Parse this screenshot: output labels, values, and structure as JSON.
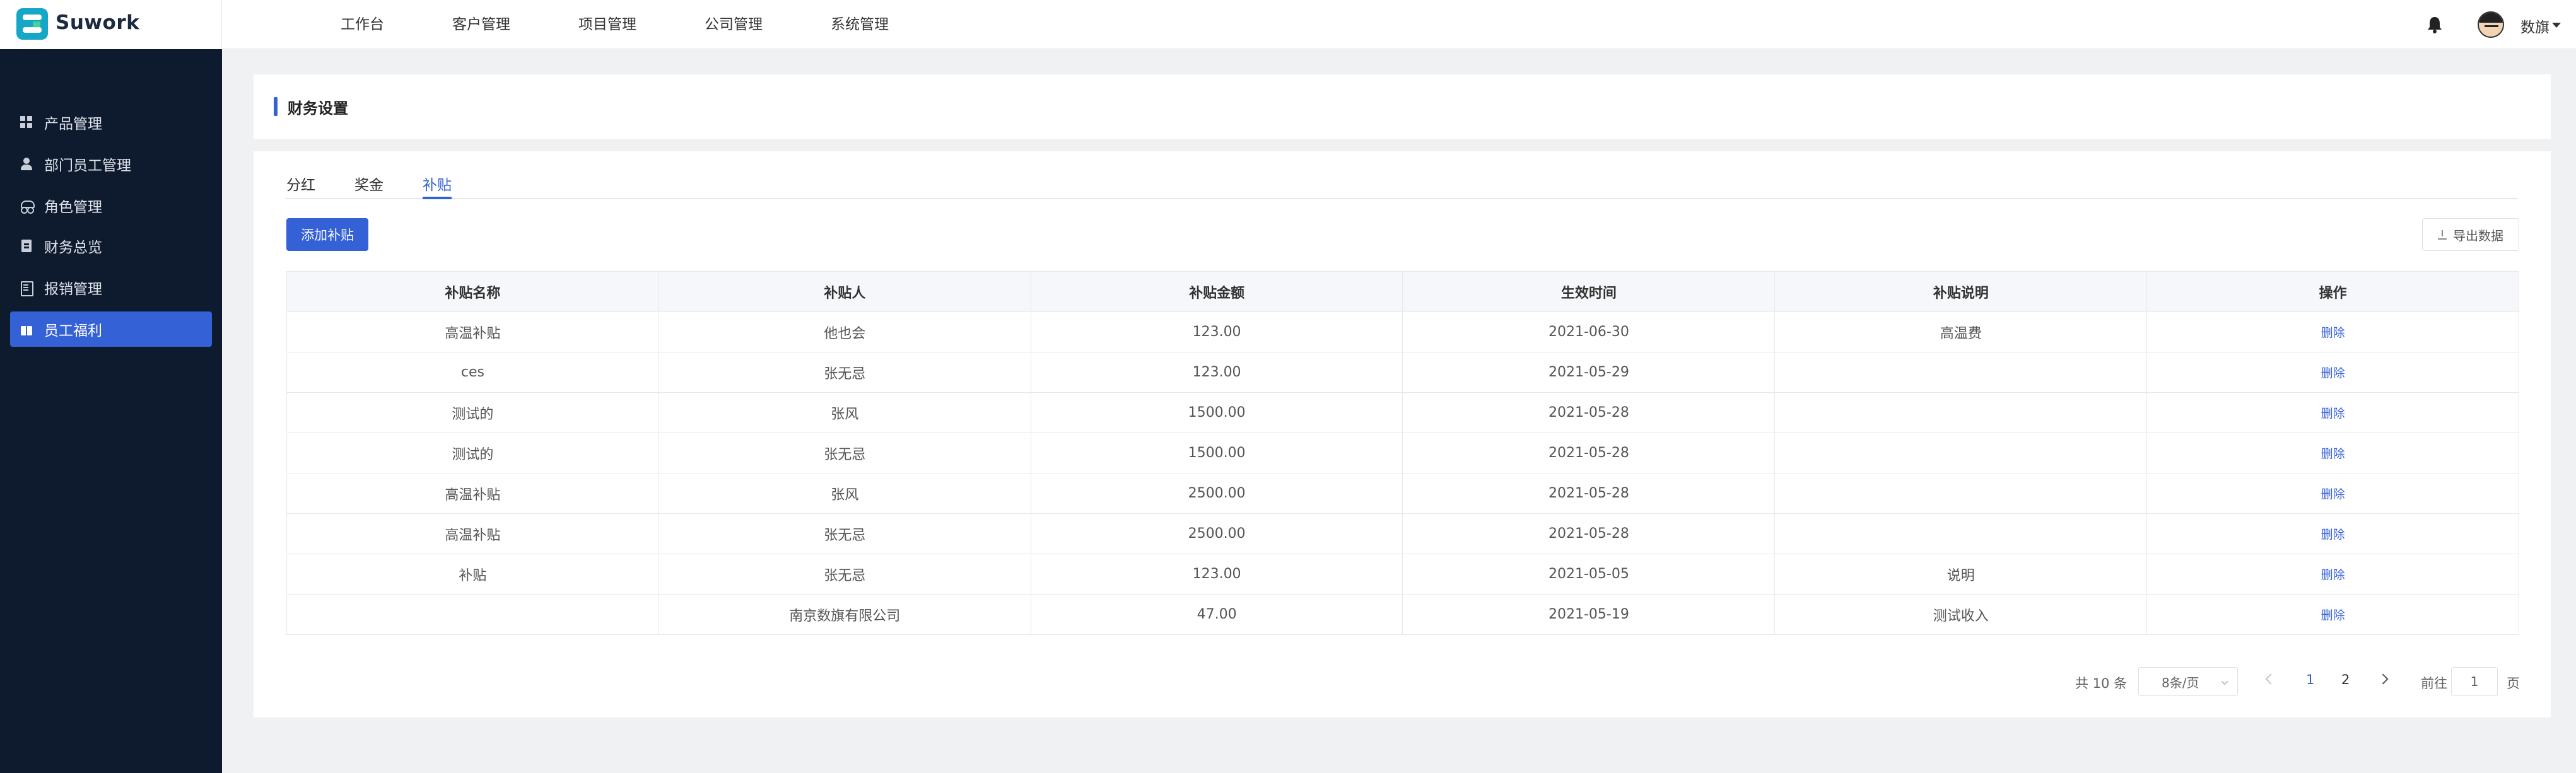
{
  "app": {
    "logo_text": "Suwork"
  },
  "topnav": [
    "工作台",
    "客户管理",
    "项目管理",
    "公司管理",
    "系统管理"
  ],
  "user": {
    "name": "数旗"
  },
  "sidebar": {
    "items": [
      {
        "label": "产品管理",
        "icon": "grid-icon"
      },
      {
        "label": "部门员工管理",
        "icon": "user-icon"
      },
      {
        "label": "角色管理",
        "icon": "role-icon"
      },
      {
        "label": "财务总览",
        "icon": "finance-icon"
      },
      {
        "label": "报销管理",
        "icon": "reimburse-icon"
      },
      {
        "label": "员工福利",
        "icon": "gift-icon",
        "active": true
      }
    ]
  },
  "page": {
    "title": "财务设置"
  },
  "tabs": [
    {
      "label": "分红"
    },
    {
      "label": "奖金"
    },
    {
      "label": "补贴",
      "active": true
    }
  ],
  "toolbar": {
    "add_label": "添加补贴",
    "export_label": "导出数据"
  },
  "table": {
    "headers": [
      "补贴名称",
      "补贴人",
      "补贴金额",
      "生效时间",
      "补贴说明",
      "操作"
    ],
    "rows": [
      [
        "高温补贴",
        "他也会",
        "123.00",
        "2021-06-30",
        "高温费",
        "删除"
      ],
      [
        "ces",
        "张无忌",
        "123.00",
        "2021-05-29",
        "",
        "删除"
      ],
      [
        "测试的",
        "张风",
        "1500.00",
        "2021-05-28",
        "",
        "删除"
      ],
      [
        "测试的",
        "张无忌",
        "1500.00",
        "2021-05-28",
        "",
        "删除"
      ],
      [
        "高温补贴",
        "张风",
        "2500.00",
        "2021-05-28",
        "",
        "删除"
      ],
      [
        "高温补贴",
        "张无忌",
        "2500.00",
        "2021-05-28",
        "",
        "删除"
      ],
      [
        "补贴",
        "张无忌",
        "123.00",
        "2021-05-05",
        "说明",
        "删除"
      ],
      [
        "",
        "南京数旗有限公司",
        "47.00",
        "2021-05-19",
        "测试收入",
        "删除"
      ]
    ]
  },
  "pagination": {
    "total": "共 10 条",
    "page_size": "8条/页",
    "pages": [
      "1",
      "2"
    ],
    "current": "1",
    "goto_label": "前往",
    "goto_value": "1",
    "page_suffix": "页"
  },
  "colors": {
    "accent": "#3561d6",
    "sidebar_bg": "#0e1a2e"
  }
}
